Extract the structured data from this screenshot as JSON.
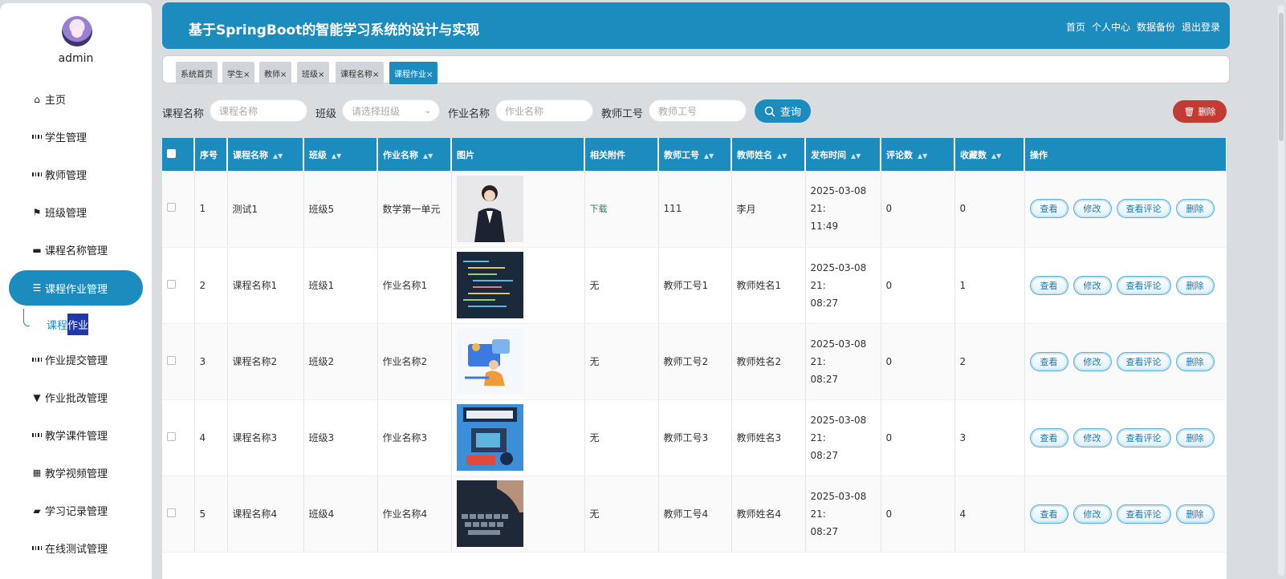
{
  "user": {
    "name": "admin"
  },
  "menu": [
    {
      "label": "主页",
      "icon": "home-icon"
    },
    {
      "label": "学生管理",
      "icon": "grid-icon"
    },
    {
      "label": "教师管理",
      "icon": "grid-icon"
    },
    {
      "label": "班级管理",
      "icon": "flag-icon"
    },
    {
      "label": "课程名称管理",
      "icon": "book-icon"
    },
    {
      "label": "课程作业管理",
      "icon": "list-icon",
      "active": true
    },
    {
      "label": "作业提交管理",
      "icon": "grid-icon"
    },
    {
      "label": "作业批改管理",
      "icon": "stamp-icon"
    },
    {
      "label": "教学课件管理",
      "icon": "grid-icon"
    },
    {
      "label": "教学视频管理",
      "icon": "grid9-icon"
    },
    {
      "label": "学习记录管理",
      "icon": "folder-icon"
    },
    {
      "label": "在线测试管理",
      "icon": "grid-icon"
    }
  ],
  "submenu": {
    "label_a": "课程",
    "label_b": "作业"
  },
  "header": {
    "title": "基于SpringBoot的智能学习系统的设计与实现",
    "nav": [
      "首页",
      "个人中心",
      "数据备份",
      "退出登录"
    ]
  },
  "tabs": [
    {
      "label": "系统首页"
    },
    {
      "label": "学生×"
    },
    {
      "label": "教师×"
    },
    {
      "label": "班级×"
    },
    {
      "label": "课程名称×"
    },
    {
      "label": "课程作业×",
      "active": true
    }
  ],
  "search": {
    "course_label": "课程名称",
    "course_placeholder": "课程名称",
    "class_label": "班级",
    "class_placeholder": "请选择班级",
    "hw_label": "作业名称",
    "hw_placeholder": "作业名称",
    "teacher_label": "教师工号",
    "teacher_placeholder": "教师工号",
    "query_button": "查询",
    "delete_button": "删除"
  },
  "table": {
    "headers": [
      "序号",
      "课程名称",
      "班级",
      "作业名称",
      "图片",
      "相关附件",
      "教师工号",
      "教师姓名",
      "发布时间",
      "评论数",
      "收藏数",
      "操作"
    ],
    "rows": [
      {
        "no": "1",
        "course": "测试1",
        "class": "班级5",
        "hw": "数学第一单元",
        "attach": "下载",
        "tid": "111",
        "tname": "李月",
        "date": "2025-03-08 21:",
        "time": "11:49",
        "comments": "0",
        "fav": "0"
      },
      {
        "no": "2",
        "course": "课程名称1",
        "class": "班级1",
        "hw": "作业名称1",
        "attach": "无",
        "tid": "教师工号1",
        "tname": "教师姓名1",
        "date": "2025-03-08 21:",
        "time": "08:27",
        "comments": "0",
        "fav": "1"
      },
      {
        "no": "3",
        "course": "课程名称2",
        "class": "班级2",
        "hw": "作业名称2",
        "attach": "无",
        "tid": "教师工号2",
        "tname": "教师姓名2",
        "date": "2025-03-08 21:",
        "time": "08:27",
        "comments": "0",
        "fav": "2"
      },
      {
        "no": "4",
        "course": "课程名称3",
        "class": "班级3",
        "hw": "作业名称3",
        "attach": "无",
        "tid": "教师工号3",
        "tname": "教师姓名3",
        "date": "2025-03-08 21:",
        "time": "08:27",
        "comments": "0",
        "fav": "3"
      },
      {
        "no": "5",
        "course": "课程名称4",
        "class": "班级4",
        "hw": "作业名称4",
        "attach": "无",
        "tid": "教师工号4",
        "tname": "教师姓名4",
        "date": "2025-03-08 21:",
        "time": "08:27",
        "comments": "0",
        "fav": "4"
      }
    ],
    "actions": {
      "view": "查看",
      "edit": "修改",
      "comments": "查看评论",
      "delete": "删除"
    },
    "thumb_icons": [
      "woman-portrait-image",
      "code-screen-image",
      "illustration-image",
      "programming-poster-image",
      "keyboard-image"
    ]
  },
  "colors": {
    "primary": "#1c8bbe",
    "danger": "#c43b34",
    "download": "#1a8a68"
  }
}
